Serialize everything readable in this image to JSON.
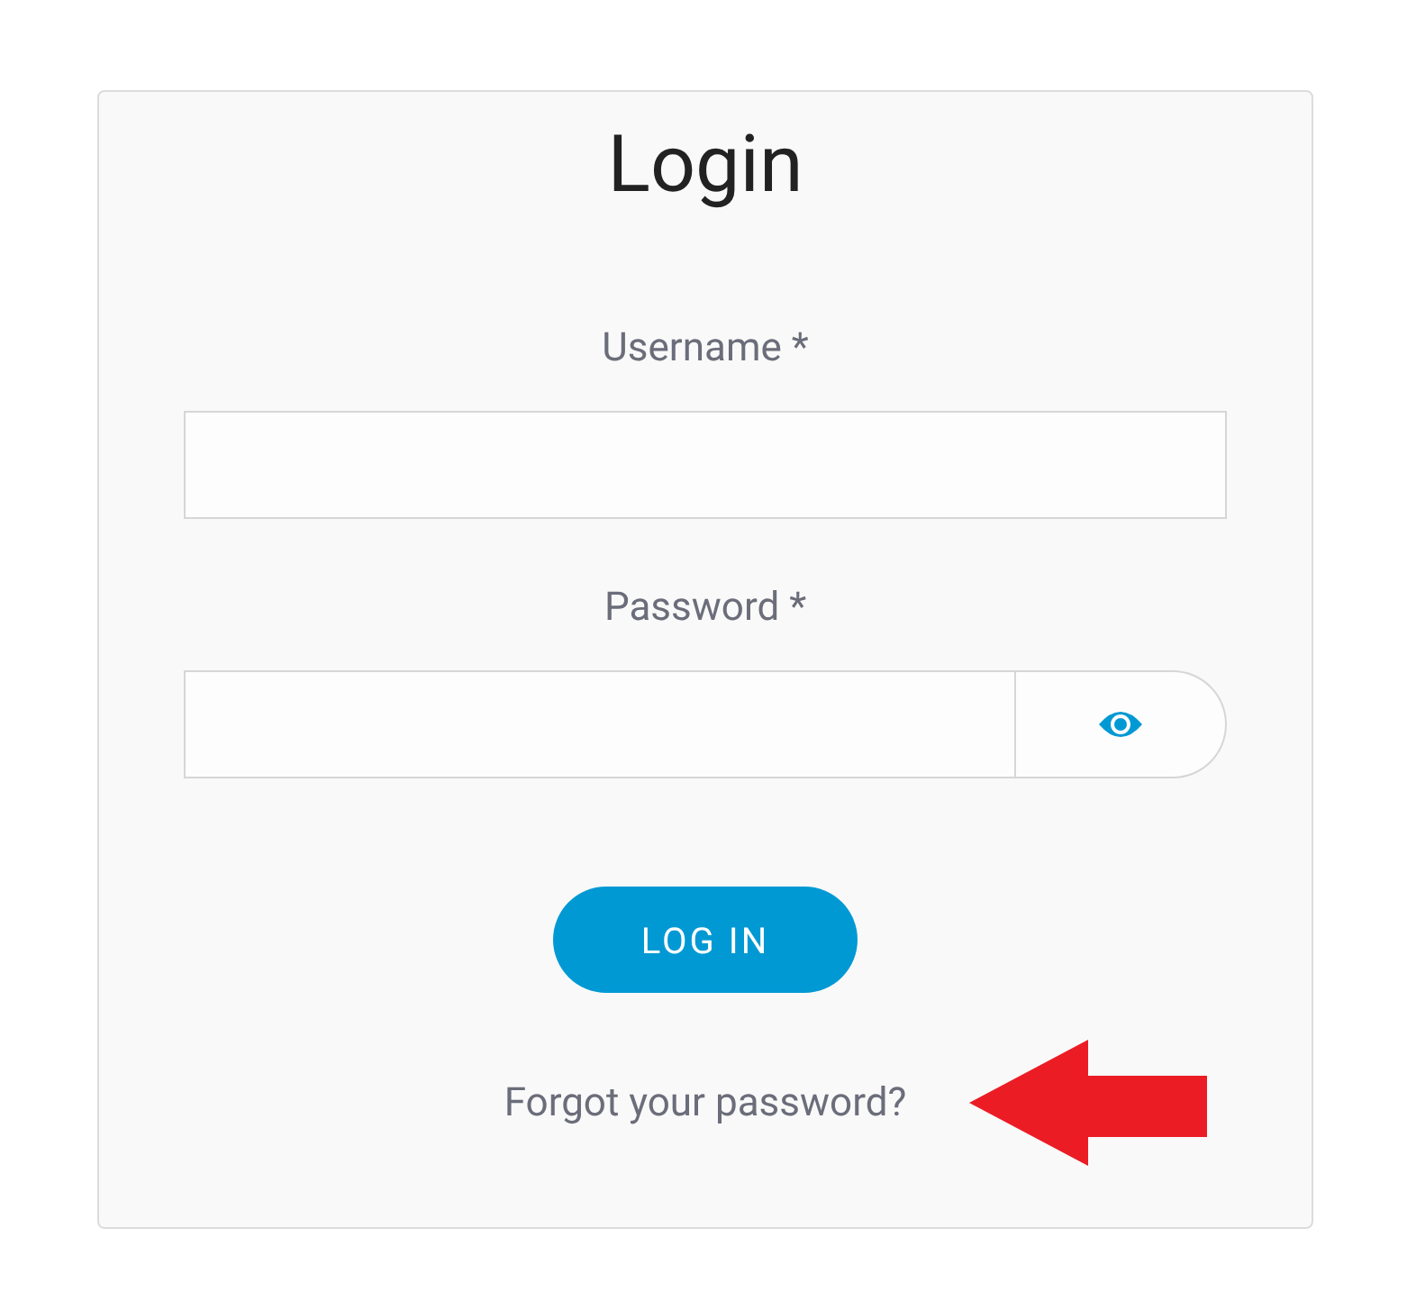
{
  "title": "Login",
  "fields": [
    {
      "label": "Username *",
      "kind": "text"
    },
    {
      "label": "Password *",
      "kind": "password"
    }
  ],
  "submit": "LOG IN",
  "forgot_link": "Forgot your password?"
}
